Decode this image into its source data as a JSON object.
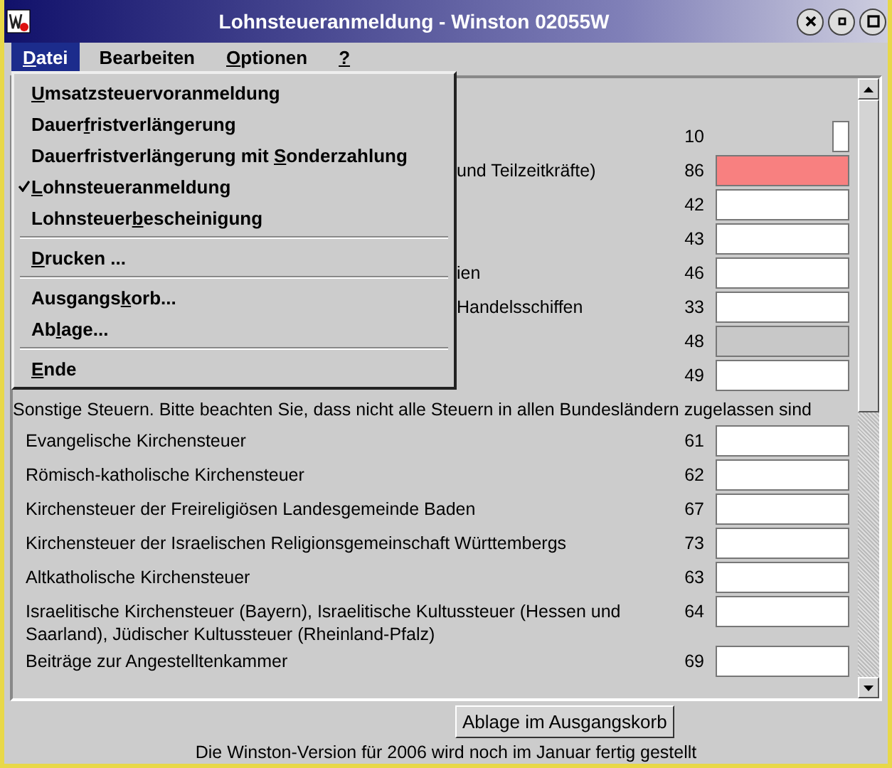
{
  "window": {
    "title": "Lohnsteueranmeldung - Winston 02055W"
  },
  "menubar": [
    {
      "key": "D",
      "post": "atei",
      "selected": true
    },
    {
      "pre": "Bearbeiten",
      "selected": false
    },
    {
      "key": "O",
      "post": "ptionen",
      "selected": false
    },
    {
      "key": "?",
      "selected": false
    }
  ],
  "menu": [
    {
      "kind": "item",
      "key": "U",
      "post": "msatzsteuervoranmeldung",
      "checked": false
    },
    {
      "kind": "item",
      "pre": "Dauer",
      "key": "f",
      "post": "ristverlängerung",
      "checked": false
    },
    {
      "kind": "item",
      "pre": "Dauerfristverlängerung mit ",
      "key": "S",
      "post": "onderzahlung",
      "checked": false
    },
    {
      "kind": "item",
      "key": "L",
      "post": "ohnsteueranmeldung",
      "checked": true
    },
    {
      "kind": "item",
      "pre": "Lohnsteuer",
      "key": "b",
      "post": "escheinigung",
      "checked": false
    },
    {
      "kind": "separator"
    },
    {
      "kind": "item",
      "key": "D",
      "post": "rucken ...",
      "checked": false
    },
    {
      "kind": "separator"
    },
    {
      "kind": "item",
      "pre": "Ausgangs",
      "key": "k",
      "post": "orb...",
      "checked": false
    },
    {
      "kind": "item",
      "pre": "Ab",
      "key": "l",
      "post": "age...",
      "checked": false
    },
    {
      "kind": "separator"
    },
    {
      "kind": "item",
      "key": "E",
      "post": "nde",
      "checked": false
    }
  ],
  "covered_rows": [
    {
      "code": "10",
      "small": true,
      "error": false,
      "disabled": false
    },
    {
      "label": "und Teilzeitkräfte)",
      "code": "86",
      "small": false,
      "error": true,
      "disabled": false
    },
    {
      "code": "42",
      "small": false,
      "error": false,
      "disabled": false
    },
    {
      "code": "43",
      "small": false,
      "error": false,
      "disabled": false
    },
    {
      "label": "ien",
      "code": "46",
      "small": false,
      "error": false,
      "disabled": false
    },
    {
      "label": "Handelsschiffen",
      "code": "33",
      "small": false,
      "error": false,
      "disabled": false
    },
    {
      "code": "48",
      "small": false,
      "error": false,
      "disabled": true
    },
    {
      "code": "49",
      "small": false,
      "error": false,
      "disabled": false
    }
  ],
  "section": {
    "heading": "Sonstige Steuern. Bitte beachten Sie, dass nicht alle Steuern in allen Bundesländern zugelassen sind",
    "rows": [
      {
        "label": "Evangelische Kirchensteuer",
        "code": "61",
        "small": false,
        "error": false,
        "disabled": false
      },
      {
        "label": "Römisch-katholische Kirchensteuer",
        "code": "62",
        "small": false,
        "error": false,
        "disabled": false
      },
      {
        "label": "Kirchensteuer der Freireligiösen Landesgemeinde Baden",
        "code": "67",
        "small": false,
        "error": false,
        "disabled": false
      },
      {
        "label": "Kirchensteuer der Israelischen Religionsgemeinschaft Württembergs",
        "code": "73",
        "small": false,
        "error": false,
        "disabled": false
      },
      {
        "label": "Altkatholische Kirchensteuer",
        "code": "63",
        "small": false,
        "error": false,
        "disabled": false
      },
      {
        "label": "Israelitische Kirchensteuer (Bayern), Israelitische Kultussteuer (Hessen und Saarland), Jüdischer Kultussteuer (Rheinland-Pfalz)",
        "code": "64",
        "small": false,
        "error": false,
        "disabled": false
      },
      {
        "label": "Beiträge zur Angestelltenkammer",
        "code": "69",
        "small": false,
        "error": false,
        "disabled": false
      }
    ]
  },
  "footer": {
    "button": "Ablage im Ausgangskorb",
    "status": "Die Winston-Version für 2006 wird noch im Januar fertig gestellt"
  }
}
